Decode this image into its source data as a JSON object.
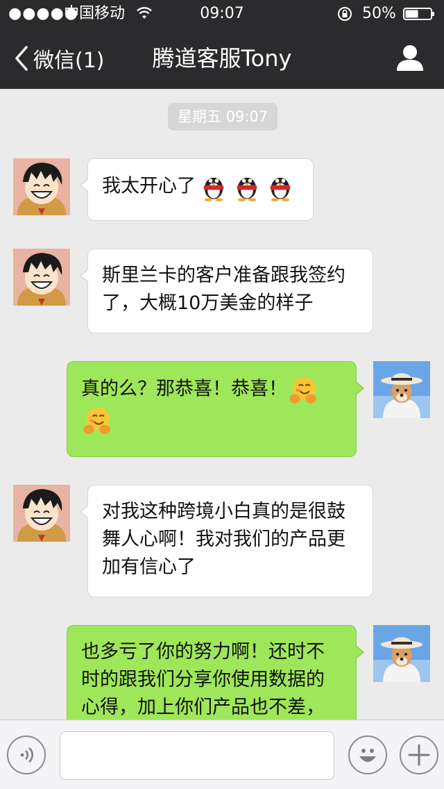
{
  "status_bar": {
    "signal_dots": "●●●●●",
    "carrier": "中国移动",
    "time": "09:07",
    "battery_percent": "50%"
  },
  "nav": {
    "back_label": "微信(1)",
    "title": "腾道客服Tony"
  },
  "chat": {
    "timestamp": "星期五 09:07",
    "messages": [
      {
        "side": "left",
        "text": "我太开心了",
        "emoji": [
          "penguin-icon",
          "penguin-icon",
          "penguin-icon"
        ]
      },
      {
        "side": "left",
        "line1": "斯里兰卡的客户准备跟我签约",
        "line2": "了，大概10万美金的样子"
      },
      {
        "side": "right",
        "text": "真的么？那恭喜！恭喜！",
        "emoji": [
          "hug-emoji-icon",
          "hug-emoji-icon"
        ]
      },
      {
        "side": "left",
        "line1": "对我这种跨境小白真的是很鼓",
        "line2": "舞人心啊！我对我们的产品更",
        "line3": "加有信心了"
      },
      {
        "side": "right",
        "line1": "也多亏了你的努力啊！还时不",
        "line2": "时的跟我们分享你使用数据的",
        "line3": "心得，加上你们产品也不差，"
      }
    ]
  },
  "input": {
    "value": ""
  },
  "colors": {
    "header_bg": "#2b2b2d",
    "chat_bg": "#ebebeb",
    "my_bubble": "#9ee75a",
    "their_bubble": "#ffffff"
  }
}
